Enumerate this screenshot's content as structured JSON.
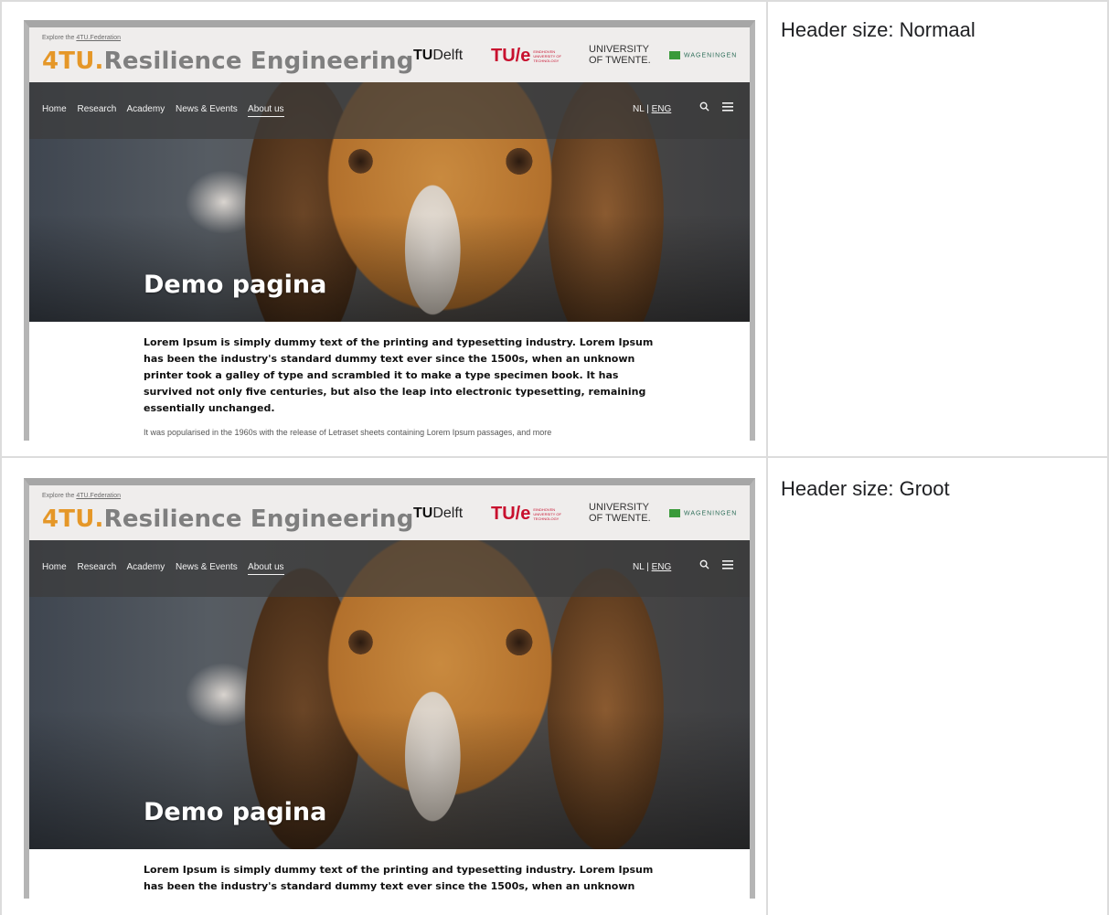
{
  "rows": [
    {
      "caption": "Header size: Normaal",
      "site": {
        "explore_prefix": "Explore the",
        "explore_link": "4TU.Federation",
        "brand_accent": "4TU.",
        "brand_name": "Resilience Engineering",
        "logos": {
          "tudelft_tu": "TU",
          "tudelft_name": "Delft",
          "tue": "TU/e",
          "tue_small": "EINDHOVEN UNIVERSITY OF TECHNOLOGY",
          "utwente_line1": "UNIVERSITY",
          "utwente_line2": "OF TWENTE.",
          "wur": "WAGENINGEN"
        },
        "nav": [
          "Home",
          "Research",
          "Academy",
          "News & Events",
          "About us"
        ],
        "lang_nl": "NL",
        "lang_sep": "|",
        "lang_eng": "ENG",
        "hero_title": "Demo pagina",
        "lead_text": "Lorem Ipsum is simply dummy text of the printing and typesetting industry. Lorem Ipsum has been the industry's standard dummy text ever since the 1500s, when an unknown printer took a galley of type and scrambled it to make a type specimen book. It has survived not only five centuries, but also the leap into electronic typesetting, remaining essentially unchanged.",
        "para_text": "It was popularised in the 1960s with the release of Letraset sheets containing Lorem Ipsum passages, and more"
      }
    },
    {
      "caption": "Header size: Groot",
      "site": {
        "explore_prefix": "Explore the",
        "explore_link": "4TU.Federation",
        "brand_accent": "4TU.",
        "brand_name": "Resilience Engineering",
        "logos": {
          "tudelft_tu": "TU",
          "tudelft_name": "Delft",
          "tue": "TU/e",
          "tue_small": "EINDHOVEN UNIVERSITY OF TECHNOLOGY",
          "utwente_line1": "UNIVERSITY",
          "utwente_line2": "OF TWENTE.",
          "wur": "WAGENINGEN"
        },
        "nav": [
          "Home",
          "Research",
          "Academy",
          "News & Events",
          "About us"
        ],
        "lang_nl": "NL",
        "lang_sep": "|",
        "lang_eng": "ENG",
        "hero_title": "Demo pagina",
        "lead_text": "Lorem Ipsum is simply dummy text of the printing and typesetting industry. Lorem Ipsum has been the industry's standard dummy text ever since the 1500s, when an unknown printer took a galley of"
      }
    }
  ],
  "colors": {
    "brand_orange": "#e59728",
    "brand_gray": "#7f7f7f",
    "tue_red": "#c8102e",
    "nav_overlay": "rgba(60,60,60,0.72)"
  },
  "icons": [
    "search-icon",
    "menu-icon"
  ]
}
